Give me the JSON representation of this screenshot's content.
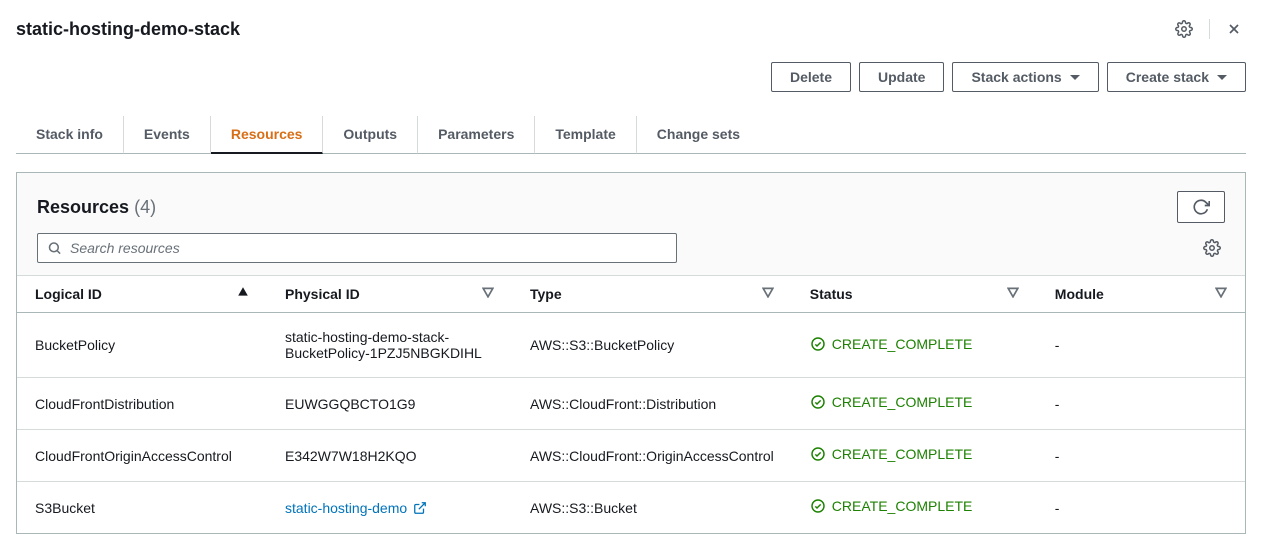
{
  "header": {
    "title": "static-hosting-demo-stack"
  },
  "actions": {
    "delete": "Delete",
    "update": "Update",
    "stack_actions": "Stack actions",
    "create_stack": "Create stack"
  },
  "tabs": [
    {
      "label": "Stack info",
      "active": false
    },
    {
      "label": "Events",
      "active": false
    },
    {
      "label": "Resources",
      "active": true
    },
    {
      "label": "Outputs",
      "active": false
    },
    {
      "label": "Parameters",
      "active": false
    },
    {
      "label": "Template",
      "active": false
    },
    {
      "label": "Change sets",
      "active": false
    }
  ],
  "panel": {
    "title": "Resources",
    "count": "(4)",
    "search_placeholder": "Search resources"
  },
  "columns": {
    "logical": "Logical ID",
    "physical": "Physical ID",
    "type": "Type",
    "status": "Status",
    "module": "Module"
  },
  "rows": [
    {
      "logical": "BucketPolicy",
      "physical": "static-hosting-demo-stack-BucketPolicy-1PZJ5NBGKDIHL",
      "physical_link": false,
      "type": "AWS::S3::BucketPolicy",
      "status": "CREATE_COMPLETE",
      "module": "-"
    },
    {
      "logical": "CloudFrontDistribution",
      "physical": "EUWGGQBCTO1G9",
      "physical_link": false,
      "type": "AWS::CloudFront::Distribution",
      "status": "CREATE_COMPLETE",
      "module": "-"
    },
    {
      "logical": "CloudFrontOriginAccessControl",
      "physical": "E342W7W18H2KQO",
      "physical_link": false,
      "type": "AWS::CloudFront::OriginAccessControl",
      "status": "CREATE_COMPLETE",
      "module": "-"
    },
    {
      "logical": "S3Bucket",
      "physical": "static-hosting-demo",
      "physical_link": true,
      "type": "AWS::S3::Bucket",
      "status": "CREATE_COMPLETE",
      "module": "-"
    }
  ]
}
